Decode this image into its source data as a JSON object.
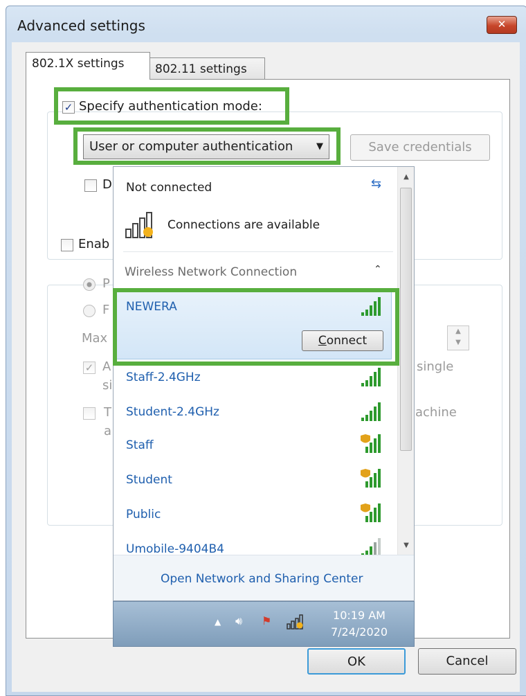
{
  "window": {
    "title": "Advanced settings",
    "close_glyph": "✕"
  },
  "tabs": [
    {
      "label": "802.1X settings",
      "active": true
    },
    {
      "label": "802.11 settings",
      "active": false
    }
  ],
  "auth": {
    "specify_label": "Specify authentication mode:",
    "specify_checked": true,
    "mode_value": "User or computer authentication",
    "save_credentials_label": "Save credentials",
    "delete_partial": "D"
  },
  "sso": {
    "enable_partial": "Enab",
    "radio_1_partial": "P",
    "radio_2_partial": "F",
    "max_partial": "Max",
    "check_a_partial": "A",
    "check_a_line2_partial": "si",
    "check_a_right": "single",
    "check_t_partial": "T",
    "check_t_line2_partial": "a",
    "check_t_right": "achine"
  },
  "flyout": {
    "status": "Not connected",
    "available": "Connections are available",
    "section": "Wireless Network Connection",
    "networks": [
      {
        "name": "NEWERA",
        "secured": false,
        "selected": true
      },
      {
        "name": "Staff-2.4GHz",
        "secured": false
      },
      {
        "name": "Student-2.4GHz",
        "secured": false
      },
      {
        "name": "Staff",
        "secured": true
      },
      {
        "name": "Student",
        "secured": true
      },
      {
        "name": "Public",
        "secured": true
      },
      {
        "name": "Umobile-9404B4",
        "secured": false
      }
    ],
    "connect_label_first": "C",
    "connect_label_rest": "onnect",
    "footer_link": "Open Network and Sharing Center"
  },
  "taskbar": {
    "time": "10:19 AM",
    "date": "7/24/2020"
  },
  "buttons": {
    "ok": "OK",
    "cancel": "Cancel"
  },
  "colors": {
    "highlight": "#58ae3e",
    "link": "#1f5fae",
    "signal": "#2e9a2e"
  }
}
